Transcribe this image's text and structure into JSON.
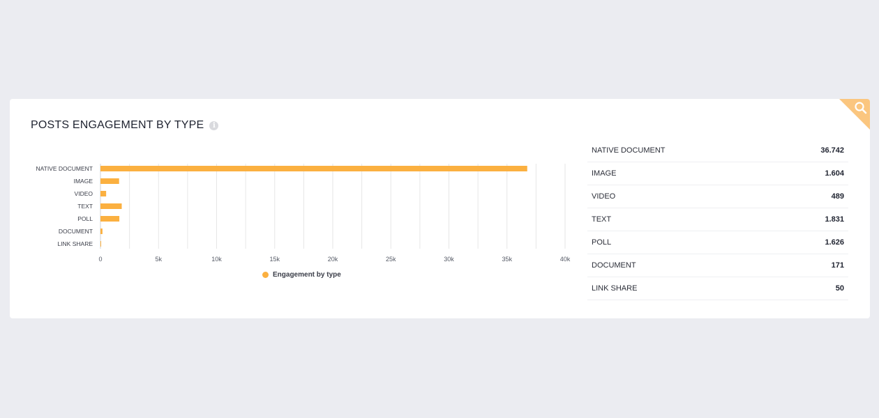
{
  "card": {
    "title": "POSTS ENGAGEMENT BY TYPE",
    "info_icon": "info-icon",
    "corner_icon": "search-icon"
  },
  "colors": {
    "accent": "#fbb040",
    "corner": "#fbc67f",
    "grid": "#e6e6e6"
  },
  "chart_data": {
    "type": "bar",
    "orientation": "horizontal",
    "categories": [
      "NATIVE DOCUMENT",
      "IMAGE",
      "VIDEO",
      "TEXT",
      "POLL",
      "DOCUMENT",
      "LINK SHARE"
    ],
    "series": [
      {
        "name": "Engagement by type",
        "values": [
          36742,
          1604,
          489,
          1831,
          1626,
          171,
          50
        ]
      }
    ],
    "x_ticks": [
      0,
      5000,
      10000,
      15000,
      20000,
      25000,
      30000,
      35000,
      40000
    ],
    "x_tick_labels": [
      "0",
      "5k",
      "10k",
      "15k",
      "20k",
      "25k",
      "30k",
      "35k",
      "40k"
    ],
    "xlim": [
      0,
      40000
    ],
    "grid": true,
    "legend_position": "bottom"
  },
  "table": {
    "rows": [
      {
        "label": "NATIVE DOCUMENT",
        "value": "36.742"
      },
      {
        "label": "IMAGE",
        "value": "1.604"
      },
      {
        "label": "VIDEO",
        "value": "489"
      },
      {
        "label": "TEXT",
        "value": "1.831"
      },
      {
        "label": "POLL",
        "value": "1.626"
      },
      {
        "label": "DOCUMENT",
        "value": "171"
      },
      {
        "label": "LINK SHARE",
        "value": "50"
      }
    ]
  }
}
